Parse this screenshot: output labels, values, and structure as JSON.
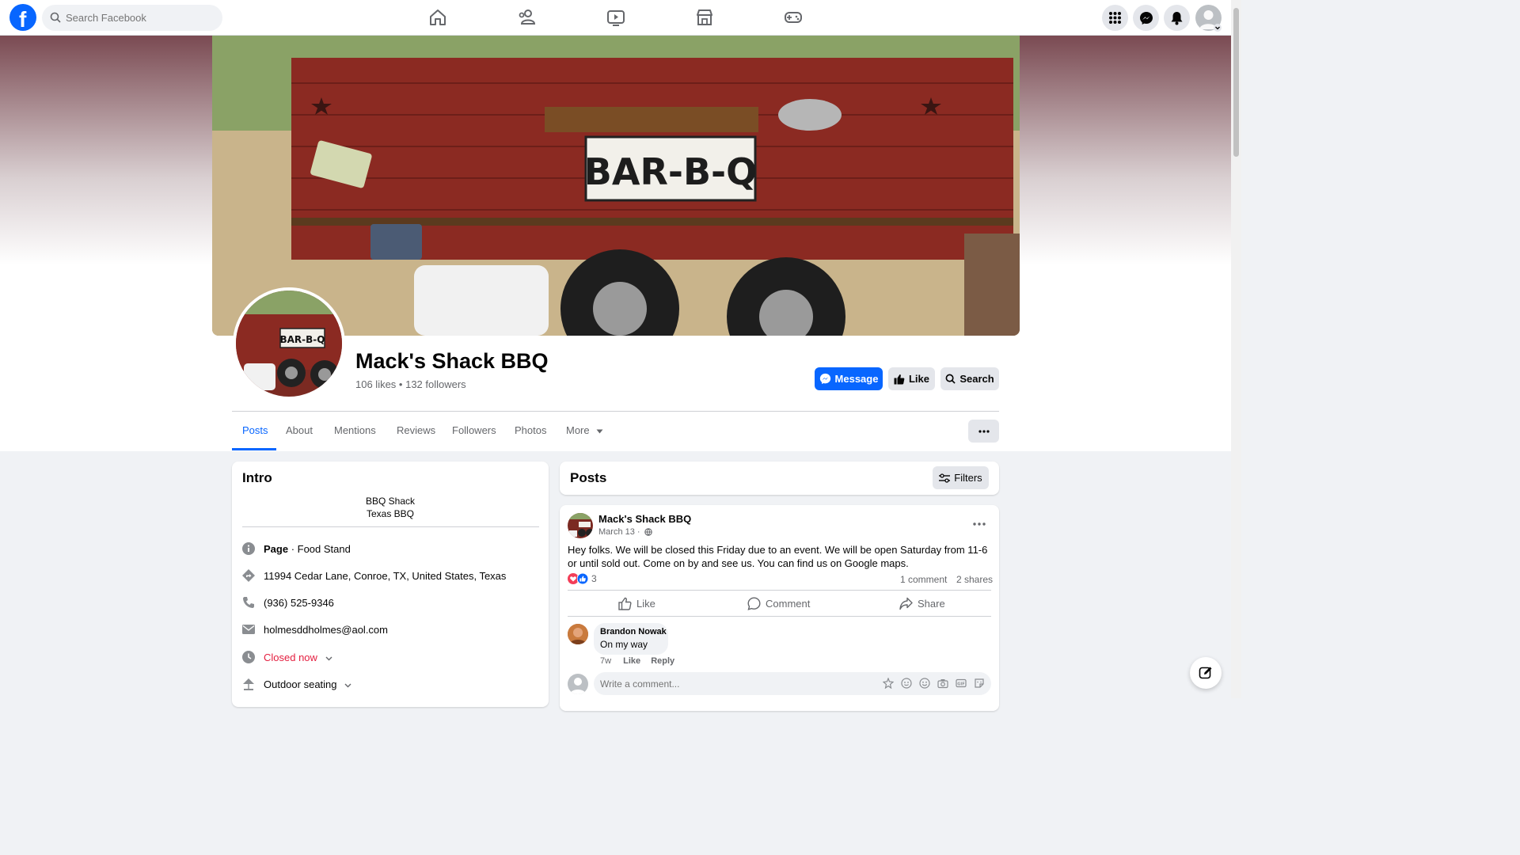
{
  "topbar": {
    "search_placeholder": "Search Facebook",
    "nav": [
      "home-icon",
      "friends-icon",
      "video-icon",
      "marketplace-icon",
      "gaming-icon"
    ],
    "actions": [
      "menu-grid-icon",
      "messenger-icon",
      "notifications-icon",
      "account-icon"
    ]
  },
  "profile": {
    "name": "Mack's Shack BBQ",
    "stats": "106 likes • 132 followers",
    "cover_text": "BAR-B-Q",
    "avatar_text": "BAR-B-Q",
    "buttons": {
      "message": "Message",
      "like": "Like",
      "search": "Search"
    }
  },
  "tabs": [
    "Posts",
    "About",
    "Mentions",
    "Reviews",
    "Followers",
    "Photos",
    "More"
  ],
  "active_tab": "Posts",
  "intro": {
    "title": "Intro",
    "bio_line1": "BBQ Shack",
    "bio_line2": "Texas BBQ",
    "page_label": "Page",
    "page_category": " · Food Stand",
    "address": "11994 Cedar Lane, Conroe, TX, United States, Texas",
    "phone": "(936) 525-9346",
    "email": "holmesddholmes@aol.com",
    "hours_status": "Closed now",
    "amenity": "Outdoor seating"
  },
  "posts_header": {
    "title": "Posts",
    "filters": "Filters"
  },
  "post": {
    "author": "Mack's Shack BBQ",
    "date": "March 13 ·",
    "text": "Hey folks. We will be closed this Friday due to an event.  We will be open Saturday from 11-6 or until sold out.  Come on by and see us. You can find us on Google maps.",
    "reactions_count": "3",
    "comments_count": "1 comment",
    "shares_count": "2 shares",
    "actions": {
      "like": "Like",
      "comment": "Comment",
      "share": "Share"
    }
  },
  "comment": {
    "author": "Brandon Nowak",
    "text": "On my way",
    "age": "7w",
    "like": "Like",
    "reply": "Reply"
  },
  "composer": {
    "placeholder": "Write a comment..."
  },
  "colors": {
    "accent": "#0866ff",
    "closed": "#e41e3f",
    "bg": "#f0f2f5"
  }
}
